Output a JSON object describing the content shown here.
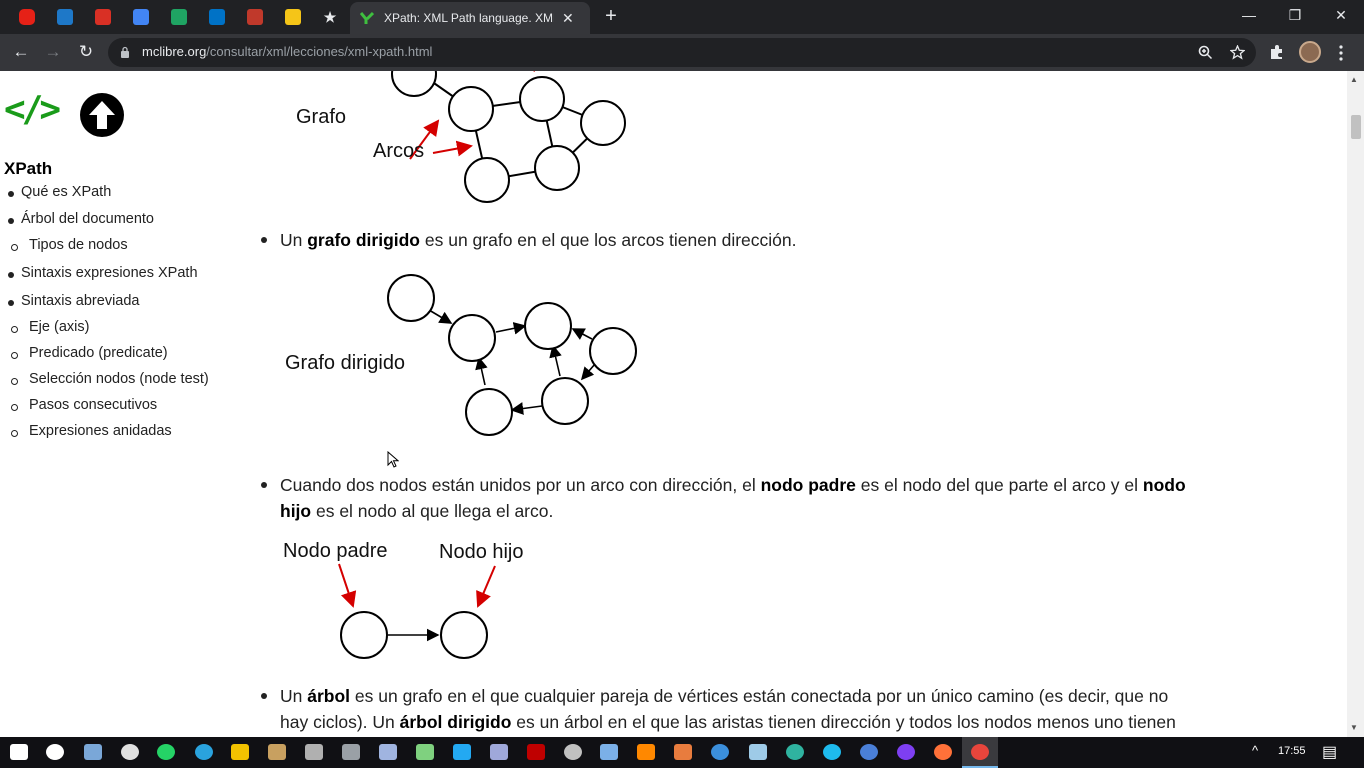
{
  "browser": {
    "active_tab_title": "XPath: XML Path language. XML.",
    "tab_close_glyph": "✕",
    "new_tab_glyph": "+",
    "url_host": "mclibre.org",
    "url_path": "/consultar/xml/lecciones/xml-xpath.html",
    "window_controls": {
      "minimize": "—",
      "restore": "❐",
      "close": "✕"
    },
    "nav": {
      "back": "←",
      "forward": "→",
      "reload": "↻"
    },
    "pinned_tabs": [
      {
        "icon": "youtube-icon",
        "color": "#e62117"
      },
      {
        "icon": "dsm-icon",
        "color": "#1e78c8"
      },
      {
        "icon": "gmail-icon",
        "color": "#d93025"
      },
      {
        "icon": "calendar-icon",
        "color": "#4285f4"
      },
      {
        "icon": "drive-icon",
        "color": "#1fa463"
      },
      {
        "icon": "mail-icon",
        "color": "#0072c6"
      },
      {
        "icon": "chrome-web-icon",
        "color": "#c0392b"
      },
      {
        "icon": "keep-icon",
        "color": "#f5c518"
      },
      {
        "icon": "star-bookmark-icon",
        "color": "#e8eaed"
      }
    ]
  },
  "sidebar": {
    "logo": "</>",
    "title": "XPath",
    "items": [
      {
        "label": "Qué es XPath",
        "level": 1
      },
      {
        "label": "Árbol del documento",
        "level": 1
      },
      {
        "label": "Tipos de nodos",
        "level": 2
      },
      {
        "label": "Sintaxis expresiones XPath",
        "level": 1
      },
      {
        "label": "Sintaxis abreviada",
        "level": 1
      },
      {
        "label": "Eje (axis)",
        "level": 2
      },
      {
        "label": "Predicado (predicate)",
        "level": 2
      },
      {
        "label": "Selección nodos (node test)",
        "level": 2
      },
      {
        "label": "Pasos consecutivos",
        "level": 2
      },
      {
        "label": "Expresiones anidadas",
        "level": 2
      }
    ]
  },
  "content": {
    "diagram1": {
      "label_graph": "Grafo",
      "label_arcs": "Arcos"
    },
    "para1": {
      "pre": "Un ",
      "bold": "grafo dirigido",
      "post": " es un grafo en el que los arcos tienen dirección."
    },
    "diagram2": {
      "label": "Grafo dirigido"
    },
    "para2": {
      "t1": "Cuando dos nodos están unidos por un arco con dirección, el ",
      "b1": "nodo padre",
      "t2": " es el nodo del que parte el arco y el ",
      "b2": "nodo",
      "b3": "hijo",
      "t3": " es el nodo al que llega el arco."
    },
    "diagram3": {
      "parent": "Nodo padre",
      "child": "Nodo hijo"
    },
    "para3": {
      "t1": "Un ",
      "b1": "árbol",
      "t2": " es un grafo en el que cualquier pareja de vértices están conectada por un único camino (es decir, que no",
      "t3": "hay ciclos). Un ",
      "b2": "árbol dirigido",
      "t4": " es un árbol en el que las aristas tienen dirección y todos los nodos menos uno tienen"
    }
  },
  "taskbar": {
    "clock": "17:55",
    "apps": [
      {
        "icon": "windows-start-icon",
        "color": "#ffffff"
      },
      {
        "icon": "task-view-icon",
        "color": "#ffffff"
      },
      {
        "icon": "keyboard-icon",
        "color": "#7aa7d8"
      },
      {
        "icon": "app-dark-icon",
        "color": "#e0e0e0"
      },
      {
        "icon": "whatsapp-icon",
        "color": "#25d366"
      },
      {
        "icon": "telegram-icon",
        "color": "#2aa3de"
      },
      {
        "icon": "file-explorer-icon",
        "color": "#f2c200"
      },
      {
        "icon": "app-stack-icon",
        "color": "#c8a060"
      },
      {
        "icon": "terminal-icon",
        "color": "#b0b0b0"
      },
      {
        "icon": "app-gray-icon",
        "color": "#9aa0a6"
      },
      {
        "icon": "document-icon",
        "color": "#a0b4e0"
      },
      {
        "icon": "notepad-icon",
        "color": "#7fd17f"
      },
      {
        "icon": "vscode-icon",
        "color": "#23a9f2"
      },
      {
        "icon": "app-bar-icon",
        "color": "#9fa8da"
      },
      {
        "icon": "filezilla-icon",
        "color": "#bf0000"
      },
      {
        "icon": "app-gear-icon",
        "color": "#c0c0c0"
      },
      {
        "icon": "virtualbox-icon",
        "color": "#7bb0e8"
      },
      {
        "icon": "vlc-icon",
        "color": "#ff8800"
      },
      {
        "icon": "app-orange-icon",
        "color": "#e87c3e"
      },
      {
        "icon": "media-player-icon",
        "color": "#3b8fdc"
      },
      {
        "icon": "screen-icon",
        "color": "#9ecbe8"
      },
      {
        "icon": "edge-icon",
        "color": "#2fb3a0"
      },
      {
        "icon": "ie-icon",
        "color": "#1ebbee"
      },
      {
        "icon": "chrome-blue-icon",
        "color": "#4a7fd8"
      },
      {
        "icon": "app-purple-icon",
        "color": "#7e3ff2"
      },
      {
        "icon": "firefox-icon",
        "color": "#ff7139"
      },
      {
        "icon": "chrome-icon",
        "color": "#e8453c"
      }
    ],
    "tray_chevron": "^",
    "notifications_icon": "▤"
  }
}
